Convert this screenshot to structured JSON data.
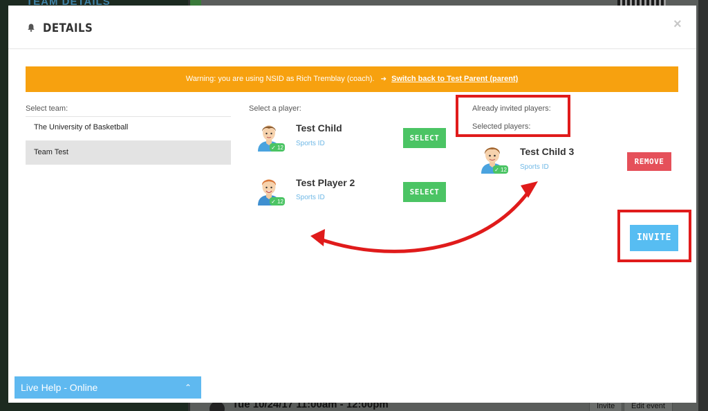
{
  "background": {
    "section_title": "TEAM DETAILS",
    "event_text": "Tue 10/24/17 11:00am - 12:00pm",
    "invite_label": "Invite",
    "edit_event_label": "Edit event"
  },
  "modal": {
    "title": "DETAILS",
    "close_label": "×"
  },
  "warning": {
    "text": "Warning: you are using NSID as Rich Tremblay (coach).",
    "link_text": "Switch back to Test Parent (parent)",
    "color": "#f7a10f"
  },
  "teams": {
    "label": "Select team:",
    "items": [
      {
        "name": "The University of Basketball"
      },
      {
        "name": "Team Test"
      }
    ]
  },
  "players": {
    "label": "Select a player:",
    "items": [
      {
        "name": "Test Child",
        "sports_id": "Sports ID",
        "badge": "12",
        "button": "SELECT"
      },
      {
        "name": "Test Player 2",
        "sports_id": "Sports ID",
        "badge": "12",
        "button": "SELECT"
      }
    ]
  },
  "invited": {
    "already_label": "Already invited players:",
    "selected_label": "Selected players:",
    "items": [
      {
        "name": "Test Child 3",
        "sports_id": "Sports ID",
        "badge": "12",
        "button": "REMOVE"
      }
    ],
    "invite_button": "INVITE"
  },
  "live_help": {
    "text": "Live Help - Online"
  },
  "colors": {
    "select_button": "#4bc464",
    "remove_button": "#e5505a",
    "invite_button": "#57bdf2",
    "annotation": "#e01b1b"
  }
}
